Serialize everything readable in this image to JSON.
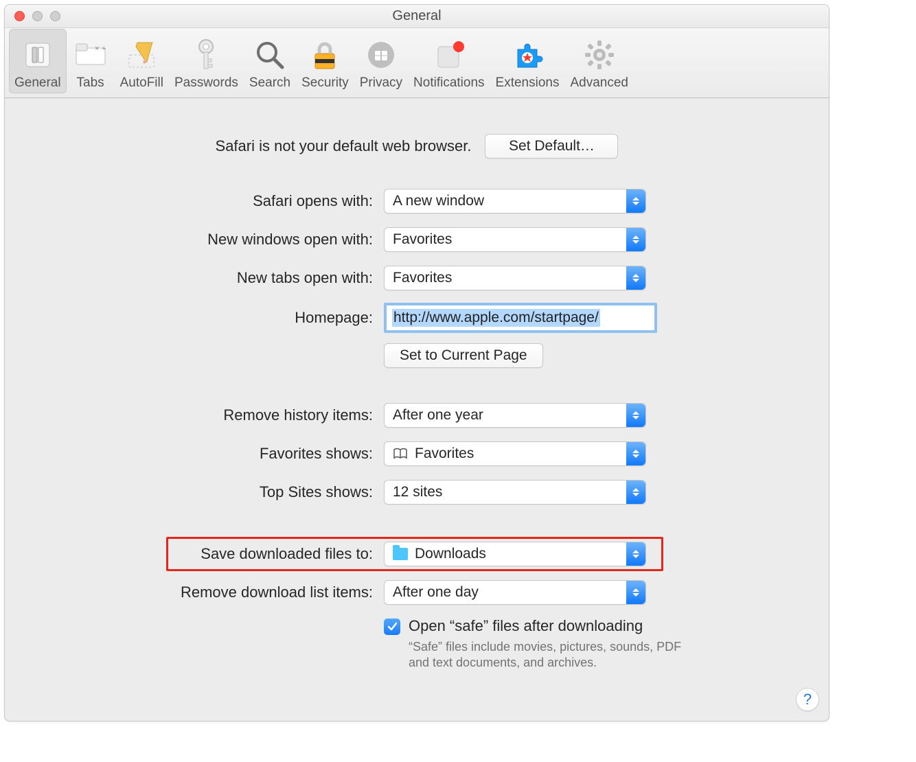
{
  "window": {
    "title": "General"
  },
  "toolbar": {
    "items": [
      {
        "label": "General"
      },
      {
        "label": "Tabs"
      },
      {
        "label": "AutoFill"
      },
      {
        "label": "Passwords"
      },
      {
        "label": "Search"
      },
      {
        "label": "Security"
      },
      {
        "label": "Privacy"
      },
      {
        "label": "Notifications"
      },
      {
        "label": "Extensions"
      },
      {
        "label": "Advanced"
      }
    ]
  },
  "default_browser": {
    "message": "Safari is not your default web browser.",
    "button": "Set Default…"
  },
  "form": {
    "opens_with": {
      "label": "Safari opens with:",
      "value": "A new window"
    },
    "new_windows": {
      "label": "New windows open with:",
      "value": "Favorites"
    },
    "new_tabs": {
      "label": "New tabs open with:",
      "value": "Favorites"
    },
    "homepage": {
      "label": "Homepage:",
      "value": "http://www.apple.com/startpage/"
    },
    "set_current": {
      "button": "Set to Current Page"
    },
    "remove_history": {
      "label": "Remove history items:",
      "value": "After one year"
    },
    "favorites_shows": {
      "label": "Favorites shows:",
      "value": "Favorites"
    },
    "topsites_shows": {
      "label": "Top Sites shows:",
      "value": "12 sites"
    },
    "save_downloads": {
      "label": "Save downloaded files to:",
      "value": "Downloads"
    },
    "remove_downloads": {
      "label": "Remove download list items:",
      "value": "After one day"
    },
    "open_safe": {
      "label": "Open “safe” files after downloading",
      "help": "“Safe” files include movies, pictures, sounds, PDF and text documents, and archives."
    }
  },
  "help_button": "?"
}
